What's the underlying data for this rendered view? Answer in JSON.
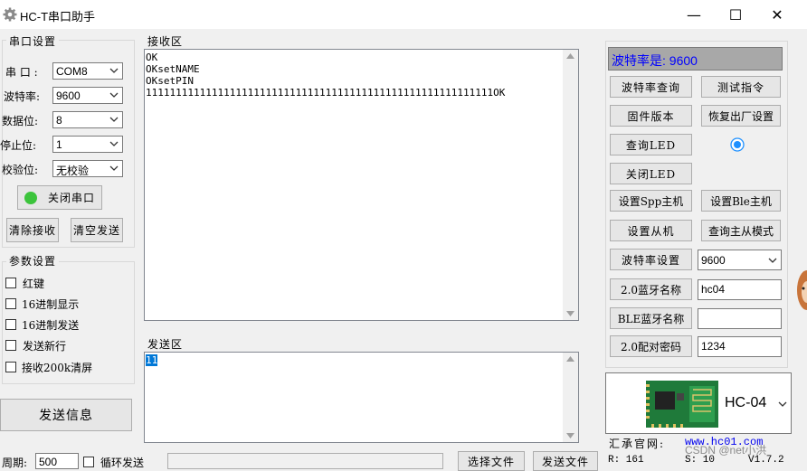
{
  "window": {
    "title": "HC-T串口助手",
    "minimize": "—",
    "maximize": "☐",
    "close": "✕"
  },
  "serial_settings": {
    "group_label": "串口设置",
    "port_label": "串 口 :",
    "port_value": "COM8",
    "baud_label": "波特率:",
    "baud_value": "9600",
    "databits_label": "数据位:",
    "databits_value": "8",
    "stopbits_label": "停止位:",
    "stopbits_value": "1",
    "parity_label": "校验位:",
    "parity_value": "无校验",
    "close_port_button": "关闭串口",
    "clear_receive_button": "清除接收",
    "clear_send_button": "清空发送"
  },
  "param_settings": {
    "group_label": "参数设置",
    "options": [
      {
        "label": "红键",
        "checked": false
      },
      {
        "label": "16进制显示",
        "checked": false
      },
      {
        "label": "16进制发送",
        "checked": false
      },
      {
        "label": "发送新行",
        "checked": false
      },
      {
        "label": "接收200k清屏",
        "checked": false
      }
    ]
  },
  "send_info_button": "发送信息",
  "bottom": {
    "period_label": "周期:",
    "period_value": "500",
    "loop_send_label": "循环发送",
    "choose_file_button": "选择文件",
    "send_file_button": "发送文件"
  },
  "receive": {
    "label": "接收区",
    "text": "OK\nOKsetNAME\nOKsetPIN\n1111111111111111111111111111111111111111111111111111111111OK"
  },
  "send": {
    "label": "发送区",
    "text": "11"
  },
  "right_panel": {
    "baud_display": "波特率是: 9600",
    "baud_query_button": "波特率查询",
    "test_cmd_button": "测试指令",
    "firmware_button": "固件版本",
    "factory_reset_button": "恢复出厂设置",
    "query_led_button": "查询LED",
    "close_led_button": "关闭LED",
    "set_spp_master_button": "设置Spp主机",
    "set_ble_master_button": "设置Ble主机",
    "set_slave_button": "设置从机",
    "query_mode_button": "查询主从模式",
    "baud_set_button": "波特率设置",
    "baud_set_value": "9600",
    "bt20_name_button": "2.0蓝牙名称",
    "bt20_name_value": "hc04",
    "ble_name_button": "BLE蓝牙名称",
    "ble_name_value": "",
    "bt20_pin_button": "2.0配对密码",
    "bt20_pin_value": "1234",
    "module_value": "HC-04",
    "website_label": "汇承官网:",
    "website_link": "www.hc01.com",
    "watermark": "CSDN @net小洪"
  },
  "status": {
    "r": "R: 161",
    "s": "S: 10",
    "version": "V1.7.2"
  },
  "colors": {
    "baud_display_text": "#0000ff",
    "led_indicator": "#1e90ff",
    "green_led": "#3cc43c"
  }
}
